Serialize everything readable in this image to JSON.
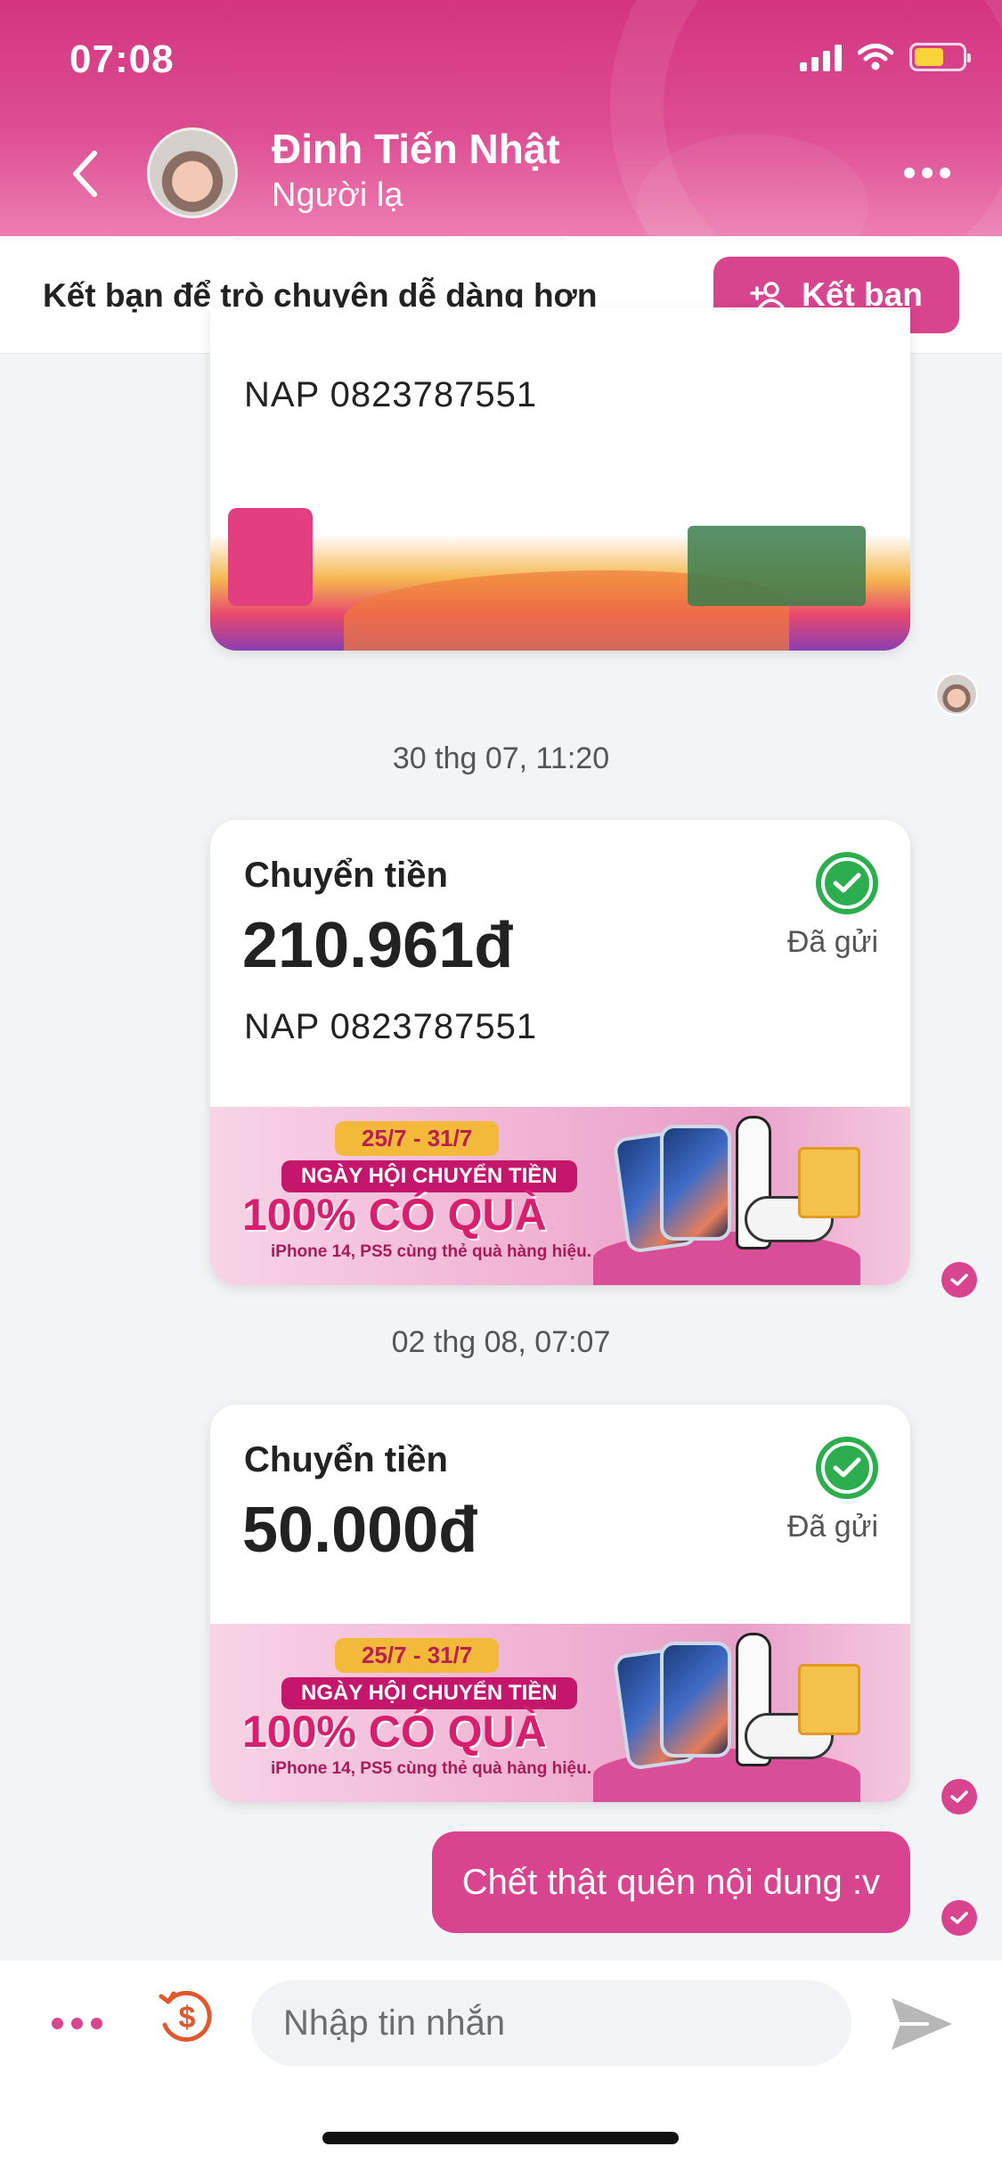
{
  "status_bar": {
    "time": "07:08"
  },
  "header": {
    "contact_name": "Đinh Tiến Nhật",
    "contact_status": "Người lạ"
  },
  "friend_bar": {
    "prompt": "Kết bạn để trò chuyện dễ dàng hơn",
    "button_label": "Kết bạn"
  },
  "messages": {
    "first_card": {
      "note": "NAP 0823787551"
    },
    "timestamp_1": "30 thg 07, 11:20",
    "transfer_1": {
      "title": "Chuyển tiền",
      "amount": "210.961đ",
      "note": "NAP 0823787551",
      "status": "Đã gửi"
    },
    "timestamp_2": "02 thg 08, 07:07",
    "transfer_2": {
      "title": "Chuyển tiền",
      "amount": "50.000đ",
      "status": "Đã gửi"
    },
    "banner": {
      "date_range": "25/7 - 31/7",
      "event": "NGÀY HỘI CHUYỂN TIỀN",
      "headline": "100% CÓ QUÀ",
      "subtext": "iPhone 14, PS5 cùng thẻ quà hàng hiệu."
    },
    "text_message": "Chết thật quên nội dung :v"
  },
  "input_bar": {
    "placeholder": "Nhập tin nhắn"
  },
  "colors": {
    "accent": "#d9448f",
    "success": "#2cae4f",
    "header_top": "#d3357f"
  }
}
